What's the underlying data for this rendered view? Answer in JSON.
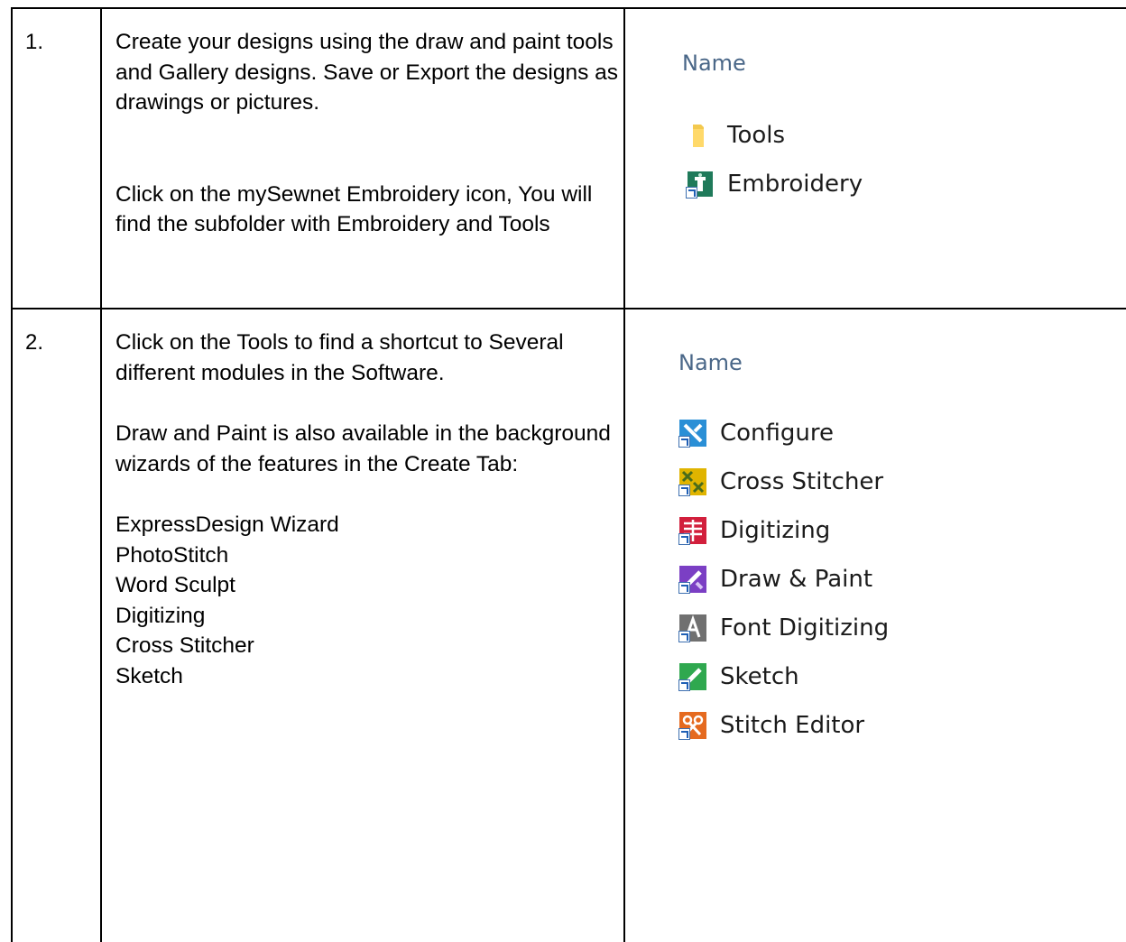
{
  "rows": [
    {
      "number": "1.",
      "paragraphs": [
        "Create your designs using the draw and paint  tools and Gallery designs. Save or Export the designs as drawings or pictures.",
        "Click on the mySewnet Embroidery icon, You will find the subfolder with Embroidery and Tools"
      ],
      "explorer": {
        "header": "Name",
        "items": [
          {
            "label": "Tools",
            "icon": "folder-icon"
          },
          {
            "label": "Embroidery",
            "icon": "embroidery-app-icon"
          }
        ]
      }
    },
    {
      "number": "2.",
      "paragraphs": [
        "Click on the Tools to find a shortcut to Several different modules in the Software.",
        "Draw and Paint is also available in the background wizards of the features in the Create Tab:"
      ],
      "list": [
        "ExpressDesign Wizard",
        "PhotoStitch",
        "Word Sculpt",
        "Digitizing",
        "Cross Stitcher",
        "Sketch"
      ],
      "explorer": {
        "header": "Name",
        "items": [
          {
            "label": "Configure",
            "icon": "configure-icon",
            "color": "#2a8fd6"
          },
          {
            "label": "Cross Stitcher",
            "icon": "cross-stitcher-icon",
            "color": "#e0b400"
          },
          {
            "label": "Digitizing",
            "icon": "digitizing-icon",
            "color": "#d21f3c"
          },
          {
            "label": "Draw & Paint",
            "icon": "draw-paint-icon",
            "color": "#7b3fc4"
          },
          {
            "label": "Font Digitizing",
            "icon": "font-digitizing-icon",
            "color": "#707070"
          },
          {
            "label": "Sketch",
            "icon": "sketch-icon",
            "color": "#2fa84f"
          },
          {
            "label": "Stitch Editor",
            "icon": "stitch-editor-icon",
            "color": "#e56a1f"
          }
        ]
      }
    }
  ]
}
